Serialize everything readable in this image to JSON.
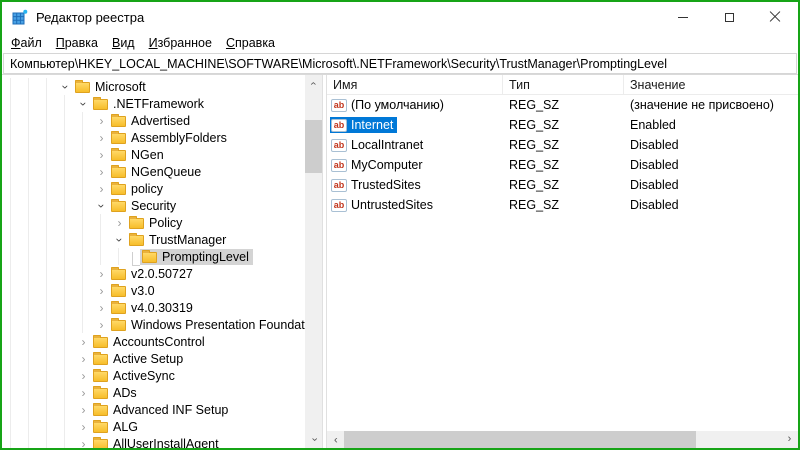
{
  "colors": {
    "screen_border": "#17a417",
    "selection_active": "#0078d7",
    "selection_inactive": "#d4d4d4",
    "folder_yellow": "#f7bd2a",
    "value_icon_red": "#c1351d"
  },
  "icons": {
    "app_icon": "registry-grid",
    "chevron": "›",
    "scroll_arrow": "›",
    "string_value": "ab",
    "folder": "folder"
  },
  "window": {
    "title": "Редактор реестра",
    "controls": [
      "minimize",
      "maximize",
      "close"
    ]
  },
  "menu": {
    "items": [
      "Файл",
      "Правка",
      "Вид",
      "Избранное",
      "Справка"
    ]
  },
  "address": {
    "path": "Компьютер\\HKEY_LOCAL_MACHINE\\SOFTWARE\\Microsoft\\.NETFramework\\Security\\TrustManager\\PromptingLevel"
  },
  "tree": {
    "items": [
      {
        "label": "Microsoft",
        "level": 3,
        "state": "expanded"
      },
      {
        "label": ".NETFramework",
        "level": 4,
        "state": "expanded"
      },
      {
        "label": "Advertised",
        "level": 5,
        "state": "collapsed"
      },
      {
        "label": "AssemblyFolders",
        "level": 5,
        "state": "collapsed"
      },
      {
        "label": "NGen",
        "level": 5,
        "state": "collapsed"
      },
      {
        "label": "NGenQueue",
        "level": 5,
        "state": "collapsed"
      },
      {
        "label": "policy",
        "level": 5,
        "state": "collapsed"
      },
      {
        "label": "Security",
        "level": 5,
        "state": "expanded"
      },
      {
        "label": "Policy",
        "level": 6,
        "state": "collapsed"
      },
      {
        "label": "TrustManager",
        "level": 6,
        "state": "expanded"
      },
      {
        "label": "PromptingLevel",
        "level": 7,
        "state": "leaf",
        "selected": true,
        "connector": true
      },
      {
        "label": "v2.0.50727",
        "level": 5,
        "state": "collapsed"
      },
      {
        "label": "v3.0",
        "level": 5,
        "state": "collapsed"
      },
      {
        "label": "v4.0.30319",
        "level": 5,
        "state": "collapsed"
      },
      {
        "label": "Windows Presentation Foundation",
        "level": 5,
        "state": "collapsed"
      },
      {
        "label": "AccountsControl",
        "level": 4,
        "state": "collapsed"
      },
      {
        "label": "Active Setup",
        "level": 4,
        "state": "collapsed"
      },
      {
        "label": "ActiveSync",
        "level": 4,
        "state": "collapsed"
      },
      {
        "label": "ADs",
        "level": 4,
        "state": "collapsed"
      },
      {
        "label": "Advanced INF Setup",
        "level": 4,
        "state": "collapsed"
      },
      {
        "label": "ALG",
        "level": 4,
        "state": "collapsed"
      },
      {
        "label": "AllUserInstallAgent",
        "level": 4,
        "state": "collapsed"
      }
    ]
  },
  "list": {
    "columns": [
      "Имя",
      "Тип",
      "Значение"
    ],
    "rows": [
      {
        "name": "(По умолчанию)",
        "type": "REG_SZ",
        "value": "(значение не присвоено)"
      },
      {
        "name": "Internet",
        "type": "REG_SZ",
        "value": "Enabled",
        "selected": true
      },
      {
        "name": "LocalIntranet",
        "type": "REG_SZ",
        "value": "Disabled"
      },
      {
        "name": "MyComputer",
        "type": "REG_SZ",
        "value": "Disabled"
      },
      {
        "name": "TrustedSites",
        "type": "REG_SZ",
        "value": "Disabled"
      },
      {
        "name": "UntrustedSites",
        "type": "REG_SZ",
        "value": "Disabled"
      }
    ]
  }
}
